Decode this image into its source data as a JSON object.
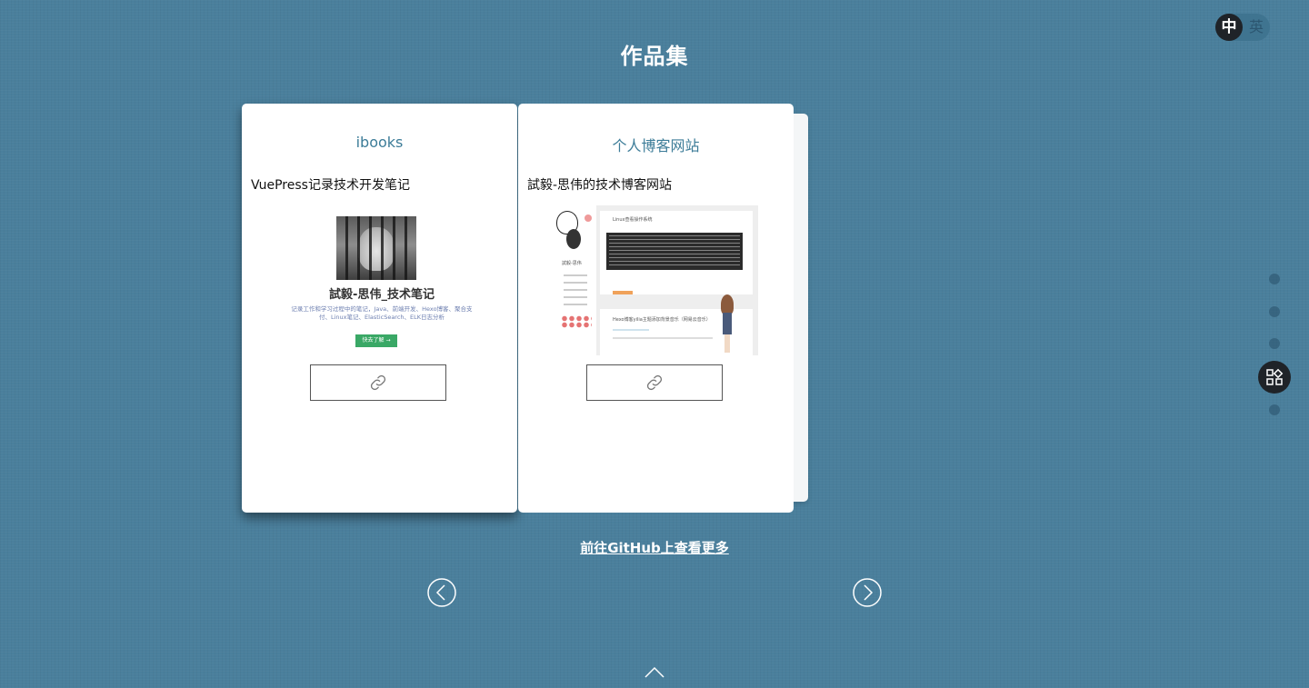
{
  "lang": {
    "zh": "中",
    "en": "英"
  },
  "page": {
    "title": "作品集"
  },
  "cards": [
    {
      "title": "ibooks",
      "description": "VuePress记录技术开发笔记",
      "thumbnail": {
        "heading": "試毅-思伟_技术笔记",
        "subtitle": "记录工作和学习过程中的笔记，Java、前端开发、Hexo博客、聚合支付、Linux笔记、ElasticSearch、ELK日志分析",
        "button": "快去了解 →"
      },
      "link_icon": "link-icon"
    },
    {
      "title": "个人博客网站",
      "description": "試毅-思伟的技术博客网站",
      "thumbnail": {
        "post1_title": "Linux查看操作系统",
        "side_name": "試毅-思伟",
        "post2_title": "Hexo博客yilia主题添加背景音乐（网易云音乐）"
      },
      "link_icon": "link-icon"
    }
  ],
  "github_link": "前往GitHub上查看更多",
  "colors": {
    "background": "#4a7f9c",
    "card_title": "#3c7c98",
    "active_nav": "#1f2328"
  },
  "icons": {
    "prev": "chevron-left-circle-icon",
    "next": "chevron-right-circle-icon",
    "up": "chevron-up-icon",
    "section_nav": "apps-icon"
  }
}
